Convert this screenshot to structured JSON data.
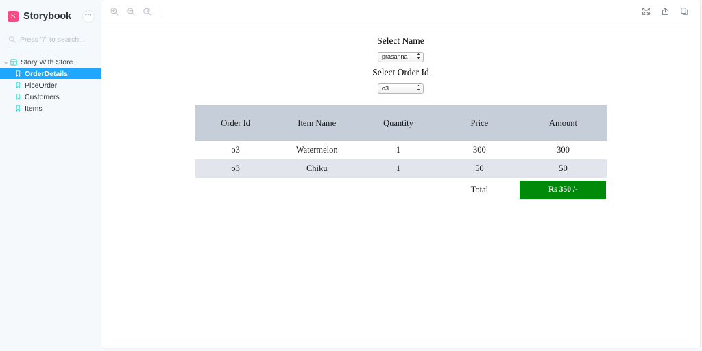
{
  "sidebar": {
    "brand": {
      "logo_letter": "S",
      "title": "Storybook",
      "menu_label": "•••",
      "logo_color": "#ff4785"
    },
    "search": {
      "placeholder": "Press \"/\" to search...",
      "value": ""
    },
    "tree": {
      "group": {
        "label": "Story With Store",
        "expanded": true
      },
      "items": [
        {
          "label": "OrderDetails",
          "selected": true
        },
        {
          "label": "PlceOrder",
          "selected": false
        },
        {
          "label": "Customers",
          "selected": false
        },
        {
          "label": "Items",
          "selected": false
        }
      ]
    },
    "selected_color": "#1ea7fd",
    "background_color": "#f6f9fc"
  },
  "toolbar": {
    "left_buttons": [
      {
        "name": "zoom-in",
        "title": "Zoom in"
      },
      {
        "name": "zoom-out",
        "title": "Zoom out"
      },
      {
        "name": "zoom-reset",
        "title": "Reset zoom"
      }
    ],
    "right_buttons": [
      {
        "name": "fullscreen",
        "title": "Go full screen"
      },
      {
        "name": "open-new-tab",
        "title": "Open canvas in new tab"
      },
      {
        "name": "copy-link",
        "title": "Copy canvas link"
      }
    ]
  },
  "story": {
    "fields": [
      {
        "label": "Select Name",
        "value": "prasanna",
        "options": [
          "prasanna"
        ]
      },
      {
        "label": "Select Order Id",
        "value": "o3",
        "options": [
          "o3"
        ]
      }
    ],
    "table": {
      "headers": [
        "Order Id",
        "Item Name",
        "Quantity",
        "Price",
        "Amount"
      ],
      "rows": [
        [
          "o3",
          "Watermelon",
          "1",
          "300",
          "300"
        ],
        [
          "o3",
          "Chiku",
          "1",
          "50",
          "50"
        ]
      ],
      "total_label": "Total",
      "total_value": "Rs 350 /-",
      "header_color": "#c5ced9",
      "stripe_color": "#e2e6ec",
      "total_color": "#008a09"
    }
  }
}
